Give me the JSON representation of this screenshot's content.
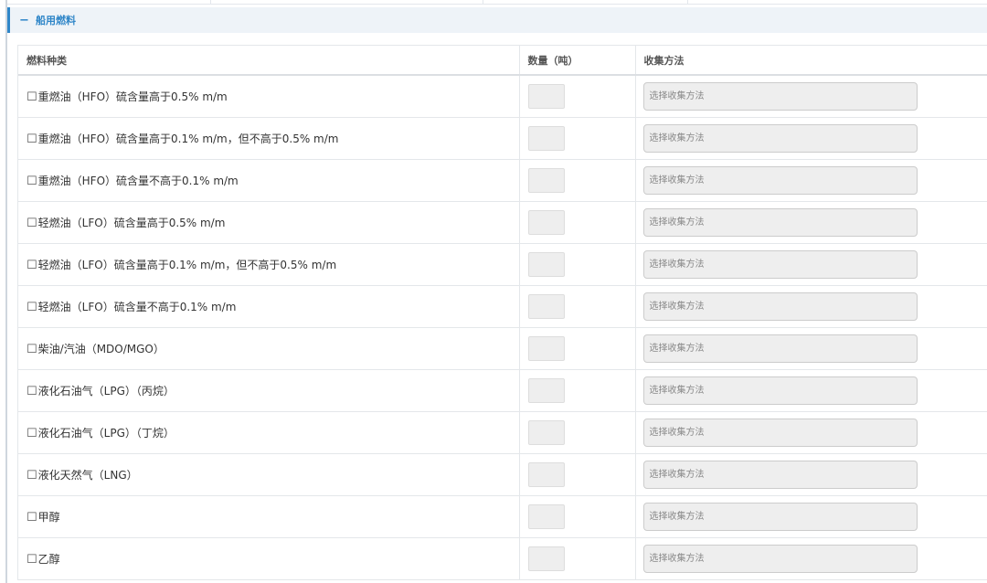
{
  "section": {
    "collapse_symbol": "−",
    "title": "船用燃料"
  },
  "table": {
    "headers": {
      "fuel_type": "燃料种类",
      "quantity": "数量（吨）",
      "method": "收集方法"
    },
    "rows": [
      {
        "checkbox": "☐",
        "label": "重燃油（HFO）硫含量高于0.5% m/m",
        "method_placeholder": "选择收集方法"
      },
      {
        "checkbox": "☐",
        "label": "重燃油（HFO）硫含量高于0.1% m/m，但不高于0.5% m/m",
        "method_placeholder": "选择收集方法"
      },
      {
        "checkbox": "☐",
        "label": "重燃油（HFO）硫含量不高于0.1% m/m",
        "method_placeholder": "选择收集方法"
      },
      {
        "checkbox": "☐",
        "label": "轻燃油（LFO）硫含量高于0.5% m/m",
        "method_placeholder": "选择收集方法"
      },
      {
        "checkbox": "☐",
        "label": "轻燃油（LFO）硫含量高于0.1% m/m，但不高于0.5% m/m",
        "method_placeholder": "选择收集方法"
      },
      {
        "checkbox": "☐",
        "label": "轻燃油（LFO）硫含量不高于0.1% m/m",
        "method_placeholder": "选择收集方法"
      },
      {
        "checkbox": "☐",
        "label": "柴油/汽油（MDO/MGO）",
        "method_placeholder": "选择收集方法"
      },
      {
        "checkbox": "☐",
        "label": "液化石油气（LPG）（丙烷）",
        "method_placeholder": "选择收集方法"
      },
      {
        "checkbox": "☐",
        "label": "液化石油气（LPG）（丁烷）",
        "method_placeholder": "选择收集方法"
      },
      {
        "checkbox": "☐",
        "label": "液化天然气（LNG）",
        "method_placeholder": "选择收集方法"
      },
      {
        "checkbox": "☐",
        "label": "甲醇",
        "method_placeholder": "选择收集方法"
      },
      {
        "checkbox": "☐",
        "label": "乙醇",
        "method_placeholder": "选择收集方法"
      }
    ]
  },
  "colors": {
    "accent": "#2f86c8",
    "header_bg": "#eef3f8",
    "input_bg": "#eeeeee",
    "border": "#e4e7ea"
  }
}
